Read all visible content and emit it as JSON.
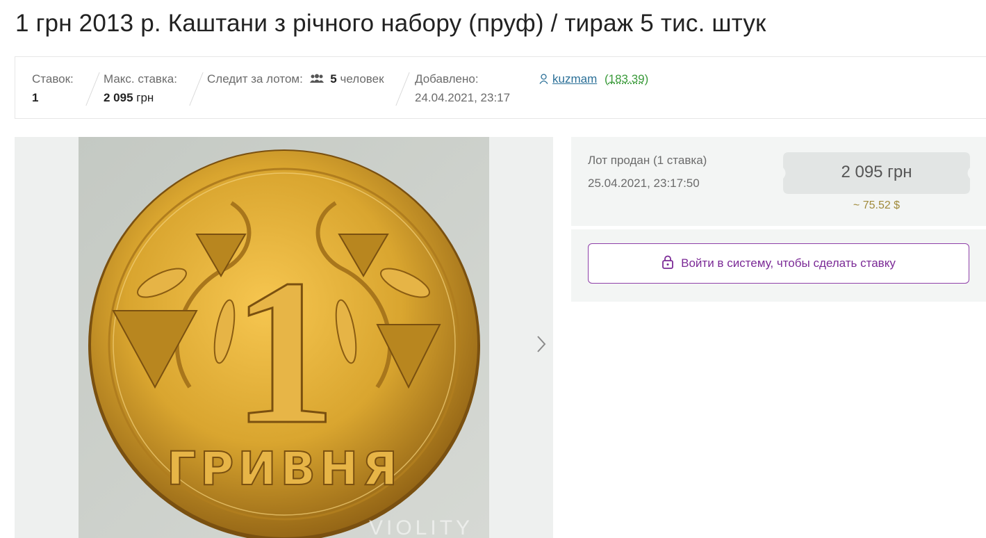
{
  "lot": {
    "title": "1 грн 2013 р. Каштани з річного набору (пруф) / тираж 5 тис. штук"
  },
  "stats": {
    "bids_label": "Ставок:",
    "bids_value": "1",
    "max_bid_label": "Макс. ставка:",
    "max_bid_amount": "2 095",
    "max_bid_currency": "грн",
    "watchers_label": "Следит за лотом:",
    "watchers_count": "5",
    "watchers_unit": "человек",
    "added_label": "Добавлено:",
    "added_date": "24.04.2021, 23:17"
  },
  "seller": {
    "name": "kuzmam",
    "rating": "183.39"
  },
  "gallery": {
    "coin_denomination": "1",
    "coin_text": "ГРИВНЯ",
    "watermark": "VIOLITY"
  },
  "sale": {
    "status": "Лот продан (1 ставка)",
    "date": "25.04.2021, 23:17:50",
    "price": "2 095 грн",
    "price_usd": "~ 75.52 $"
  },
  "login": {
    "button_label": "Войти в систему, чтобы сделать ставку"
  },
  "colors": {
    "accent_purple": "#7b2a96",
    "link_blue": "#2a6f97",
    "rating_green": "#3a9a3a",
    "coin_gold": "#d9a52f"
  }
}
